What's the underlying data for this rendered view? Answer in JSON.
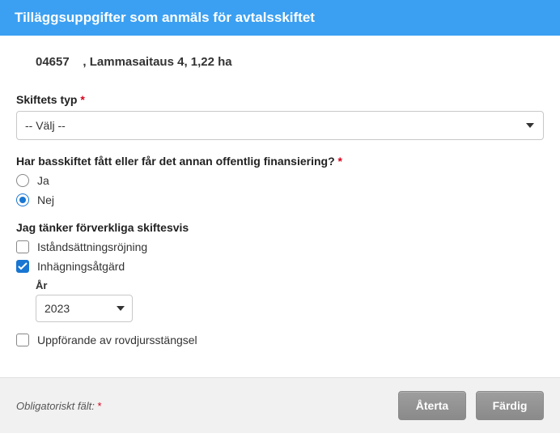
{
  "header": {
    "title": "Tilläggsuppgifter som anmäls för avtalsskiftet"
  },
  "parcel": {
    "code": "04657",
    "name_area": ", Lammasaitaus 4, 1,22 ha"
  },
  "type_field": {
    "label": "Skiftets typ",
    "required_mark": "*",
    "placeholder_option": "-- Välj --"
  },
  "funding_question": {
    "label": "Har basskiftet fått eller får det annan offentlig finansiering?",
    "required_mark": "*",
    "options": {
      "yes": "Ja",
      "no": "Nej"
    },
    "selected": "no"
  },
  "measures": {
    "label": "Jag tänker förverkliga skiftesvis",
    "items": [
      {
        "key": "clearing",
        "label": "Iståndsättningsröjning",
        "checked": false
      },
      {
        "key": "fencing",
        "label": "Inhägningsåtgärd",
        "checked": true,
        "year": {
          "label": "År",
          "value": "2023"
        }
      },
      {
        "key": "predator_fence",
        "label": "Uppförande av rovdjursstängsel",
        "checked": false
      }
    ]
  },
  "footer": {
    "required_text": "Obligatoriskt fält:",
    "required_mark": "*",
    "buttons": {
      "reset": "Återta",
      "done": "Färdig"
    }
  }
}
